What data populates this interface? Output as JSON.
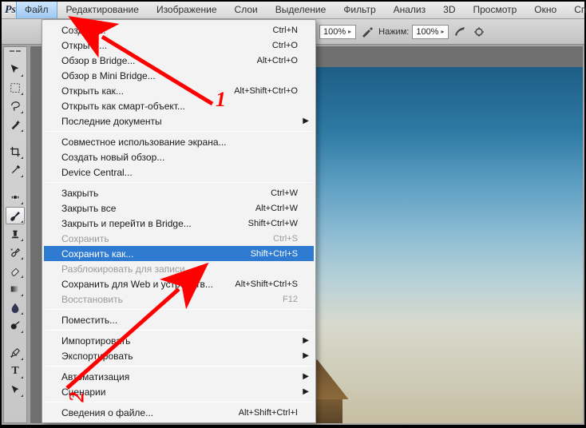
{
  "app_abbrev": "Ps",
  "menubar": {
    "items": [
      "Файл",
      "Редактирование",
      "Изображение",
      "Слои",
      "Выделение",
      "Фильтр",
      "Анализ",
      "3D",
      "Просмотр",
      "Окно",
      "Справ"
    ],
    "active_index": 0
  },
  "optionsbar": {
    "opacity_label": "100%",
    "flow_label_prefix": "Нажим:",
    "flow_value": "100%"
  },
  "file_menu": [
    {
      "label": "Создать...",
      "shortcut": "Ctrl+N"
    },
    {
      "label": "Открыть...",
      "shortcut": "Ctrl+O"
    },
    {
      "label": "Обзор в Bridge...",
      "shortcut": "Alt+Ctrl+O"
    },
    {
      "label": "Обзор в Mini Bridge..."
    },
    {
      "label": "Открыть как...",
      "shortcut": "Alt+Shift+Ctrl+O"
    },
    {
      "label": "Открыть как смарт-объект..."
    },
    {
      "label": "Последние документы",
      "submenu": true
    },
    {
      "sep": true
    },
    {
      "label": "Совместное использование экрана..."
    },
    {
      "label": "Создать новый обзор..."
    },
    {
      "label": "Device Central..."
    },
    {
      "sep": true
    },
    {
      "label": "Закрыть",
      "shortcut": "Ctrl+W"
    },
    {
      "label": "Закрыть все",
      "shortcut": "Alt+Ctrl+W"
    },
    {
      "label": "Закрыть и перейти в Bridge...",
      "shortcut": "Shift+Ctrl+W"
    },
    {
      "label": "Сохранить",
      "shortcut": "Ctrl+S",
      "disabled": true
    },
    {
      "label": "Сохранить как...",
      "shortcut": "Shift+Ctrl+S",
      "selected": true
    },
    {
      "label": "Разблокировать для записи...",
      "disabled": true
    },
    {
      "label": "Сохранить для Web и устройств...",
      "shortcut": "Alt+Shift+Ctrl+S"
    },
    {
      "label": "Восстановить",
      "shortcut": "F12",
      "disabled": true
    },
    {
      "sep": true
    },
    {
      "label": "Поместить..."
    },
    {
      "sep": true
    },
    {
      "label": "Импортировать",
      "submenu": true
    },
    {
      "label": "Экспортировать",
      "submenu": true
    },
    {
      "sep": true
    },
    {
      "label": "Автоматизация",
      "submenu": true
    },
    {
      "label": "Сценарии",
      "submenu": true
    },
    {
      "sep": true
    },
    {
      "label": "Сведения о файле...",
      "shortcut": "Alt+Shift+Ctrl+I"
    }
  ],
  "annotations": {
    "num1": "1",
    "num2": "2"
  }
}
